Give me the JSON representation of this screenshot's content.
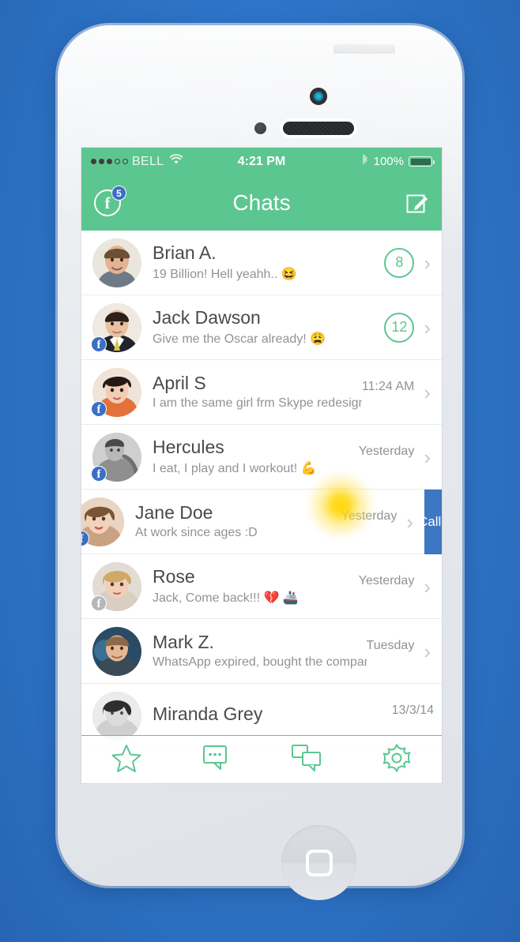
{
  "device": {
    "frame": "iphone-white",
    "background_color": "#2f76c9",
    "body_color": "#e6e9ed"
  },
  "statusbar": {
    "signal_dots_filled": 3,
    "signal_dots_total": 5,
    "carrier": "BELL",
    "wifi_icon": "wifi-icon",
    "time": "4:21 PM",
    "bluetooth_icon": "bluetooth-icon",
    "battery_percent": "100%",
    "battery_level": 100
  },
  "navbar": {
    "title": "Chats",
    "facebook_icon": "facebook-icon",
    "facebook_label": "f",
    "facebook_badge": "5",
    "compose_icon": "compose-icon",
    "accent_color": "#5cc690"
  },
  "chats": [
    {
      "name": "Brian A.",
      "message": "19 Billion! Hell yeahh.. 😆",
      "time": "",
      "unread": "8",
      "facebook_badge": false,
      "facebook_badge_gray": false,
      "swiped": false,
      "avatar": "brian-avatar"
    },
    {
      "name": "Jack Dawson",
      "message": "Give me the Oscar already! 😩",
      "time": "",
      "unread": "12",
      "facebook_badge": true,
      "facebook_badge_gray": false,
      "swiped": false,
      "avatar": "jack-avatar"
    },
    {
      "name": "April S",
      "message": "I am the same girl frm Skype redesign!",
      "time": "11:24 AM",
      "unread": "",
      "facebook_badge": true,
      "facebook_badge_gray": false,
      "swiped": false,
      "avatar": "april-avatar"
    },
    {
      "name": "Hercules",
      "message": "I eat, I play and I workout! 💪",
      "time": "Yesterday",
      "unread": "",
      "facebook_badge": true,
      "facebook_badge_gray": false,
      "swiped": false,
      "avatar": "hercules-avatar"
    },
    {
      "name": "Jane Doe",
      "message": "At work since ages :D",
      "time": "Yesterday",
      "unread": "",
      "facebook_badge": true,
      "facebook_badge_gray": false,
      "swiped": true,
      "swipe_action_label": "Call",
      "swipe_action_color": "#3d76c3",
      "avatar": "jane-avatar"
    },
    {
      "name": "Rose",
      "message": "Jack, Come back!!! 💔 🚢",
      "time": "Yesterday",
      "unread": "",
      "facebook_badge": true,
      "facebook_badge_gray": true,
      "swiped": false,
      "avatar": "rose-avatar"
    },
    {
      "name": "Mark Z.",
      "message": "WhatsApp expired, bought the company",
      "time": "Tuesday",
      "unread": "",
      "facebook_badge": false,
      "facebook_badge_gray": false,
      "swiped": false,
      "avatar": "mark-avatar"
    },
    {
      "name": "Miranda Grey",
      "message": "",
      "time": "13/3/14",
      "unread": "",
      "facebook_badge": false,
      "facebook_badge_gray": false,
      "swiped": false,
      "avatar": "miranda-avatar"
    }
  ],
  "tabbar": {
    "accent_color": "#5cc690",
    "items": [
      {
        "icon": "star-icon",
        "label": "Favorites"
      },
      {
        "icon": "chat-bubble-icon",
        "label": "Messages"
      },
      {
        "icon": "double-chat-bubble-icon",
        "label": "Chats"
      },
      {
        "icon": "gear-icon",
        "label": "Settings"
      }
    ]
  }
}
